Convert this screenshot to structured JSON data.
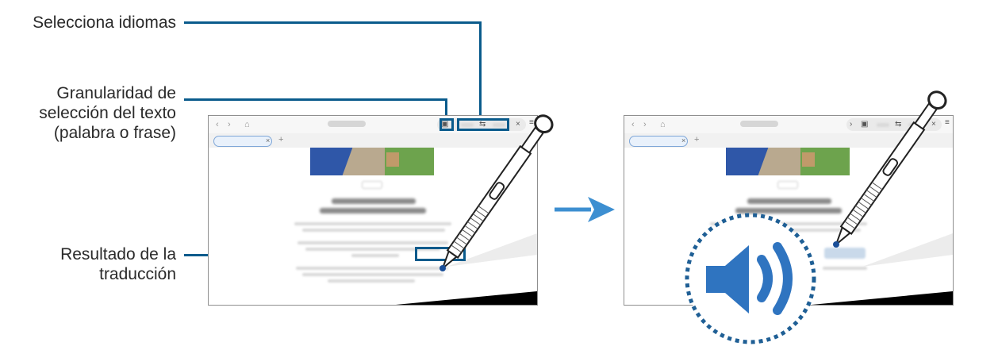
{
  "callouts": {
    "language": "Selecciona idiomas",
    "granularity": "Granularidad de selección del texto (palabra o frase)",
    "result": "Resultado de la traducción"
  },
  "icons": [
    "back-icon",
    "forward-icon",
    "home-icon",
    "text-mode-icon",
    "swap-languages-icon",
    "close-icon",
    "menu-icon",
    "add-tab-icon",
    "arrow-right-icon",
    "speaker-icon",
    "s-pen-icon"
  ],
  "colors": {
    "accent": "#0a5b8c",
    "arrow": "#3d8fd1",
    "speaker": "#2f74c0"
  }
}
